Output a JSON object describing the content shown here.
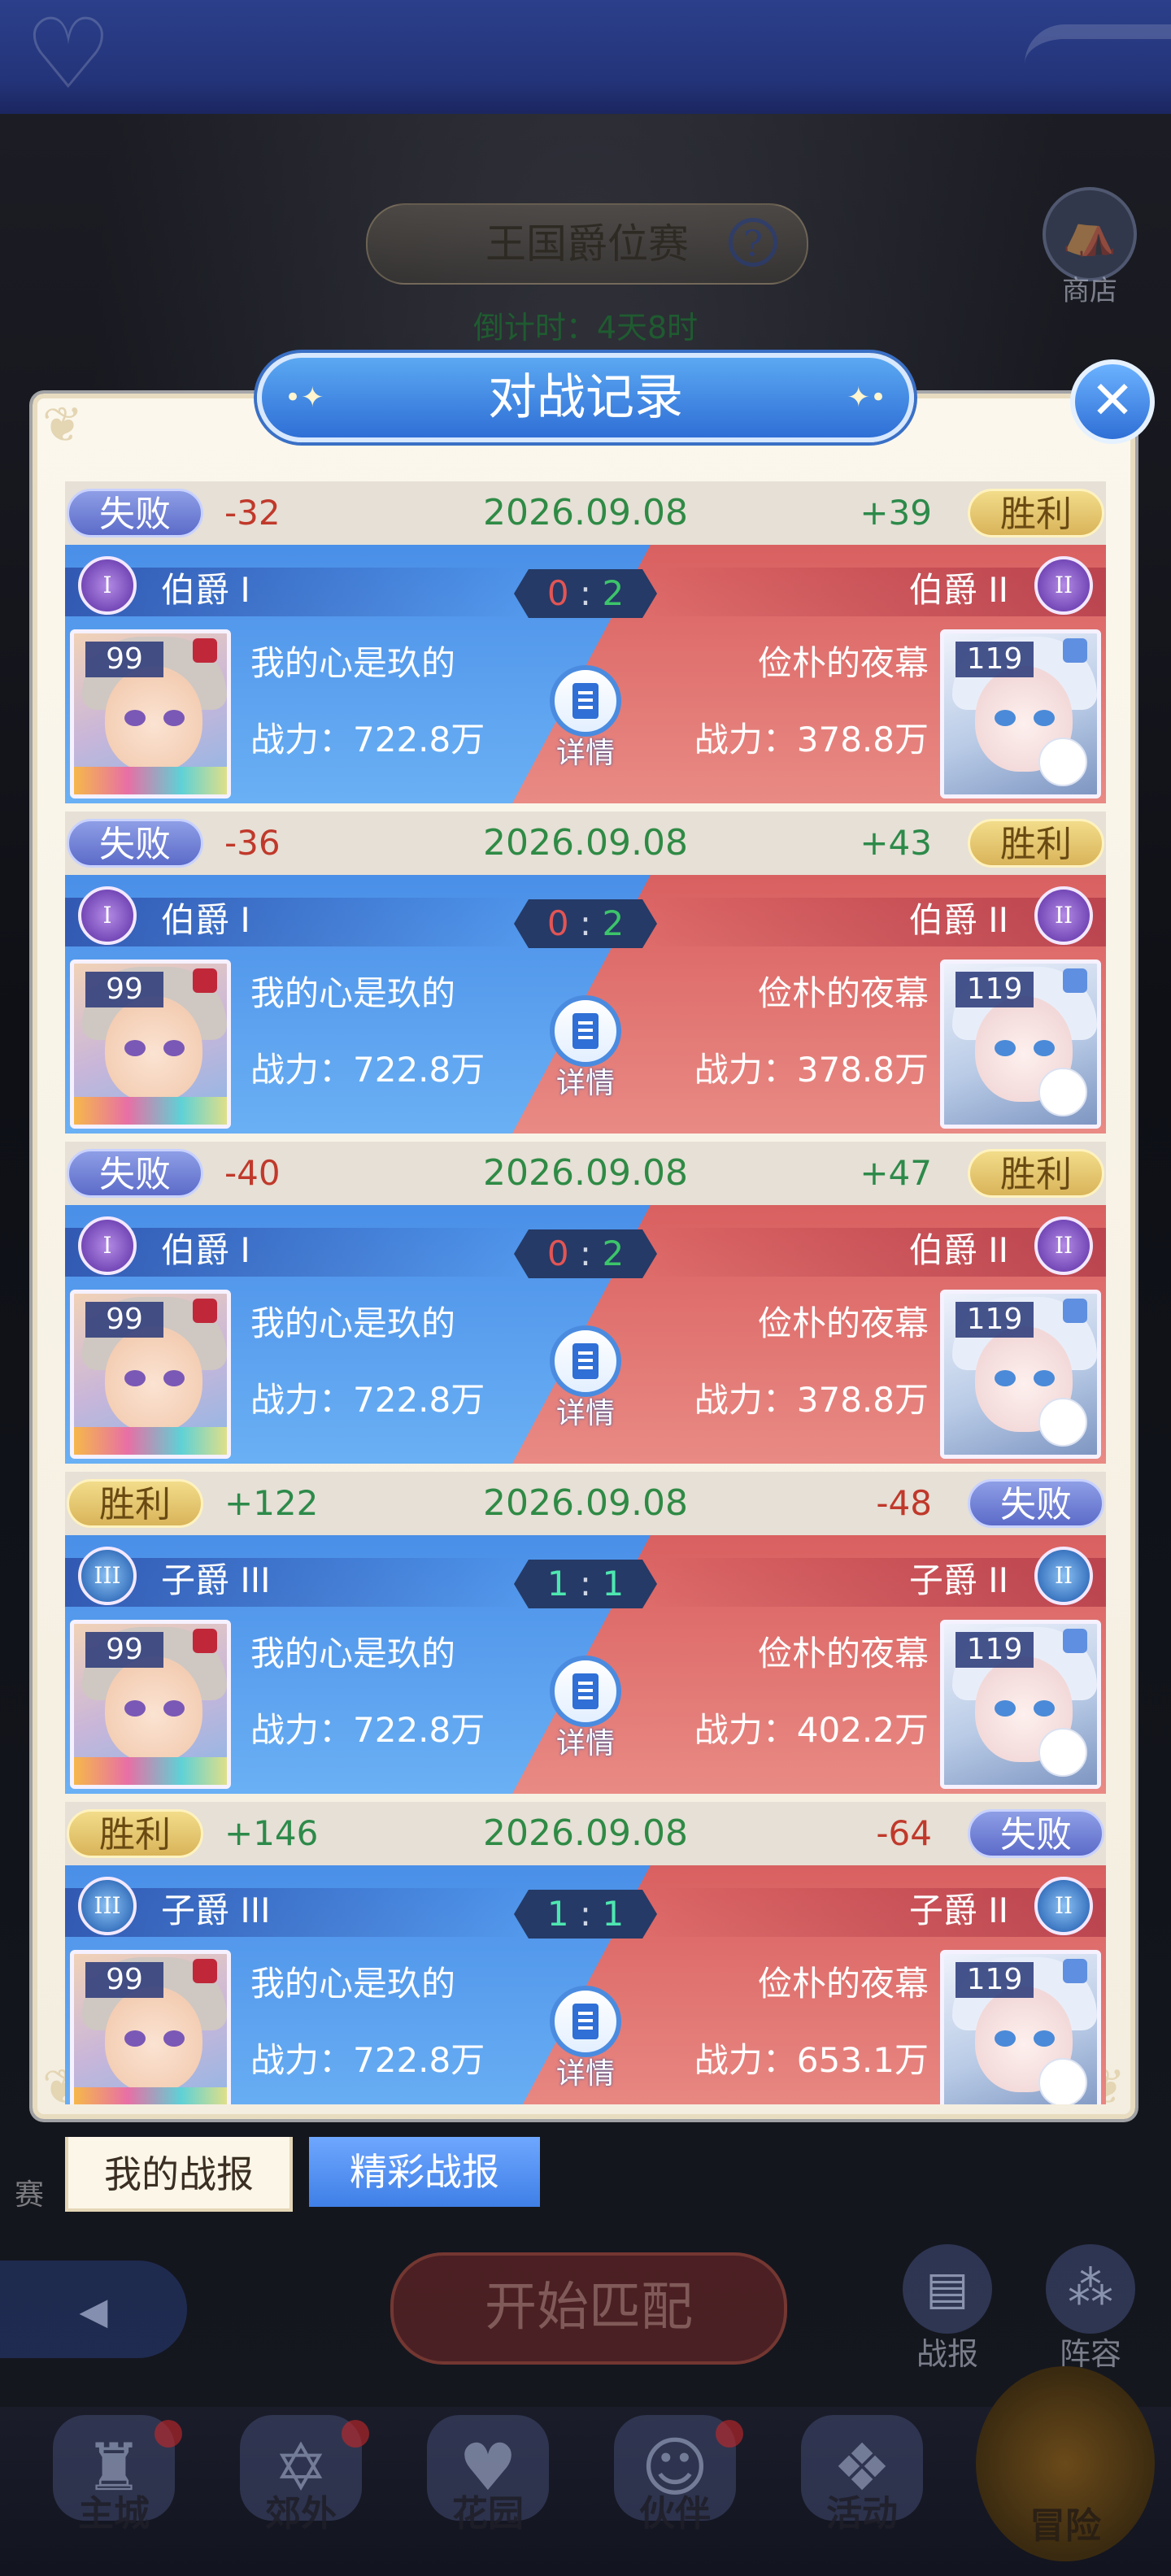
{
  "background": {
    "event_title": "王国爵位赛",
    "countdown": "倒计时：4天8时",
    "shop_label": "商店",
    "match_button": "开始匹配",
    "left_text": "赛",
    "battle_report_label": "战报",
    "lineup_label": "阵容"
  },
  "bottom_nav": {
    "items": [
      {
        "label": "主城"
      },
      {
        "label": "郊外"
      },
      {
        "label": "花园"
      },
      {
        "label": "伙伴"
      },
      {
        "label": "活动"
      },
      {
        "label": "冒险"
      }
    ]
  },
  "modal": {
    "title": "对战记录",
    "close_label": "✕",
    "detail_label": "详情",
    "records": [
      {
        "left_result": "失败",
        "left_delta": "-32",
        "date": "2026.09.08",
        "right_delta": "+39",
        "right_result": "胜利",
        "left_rank": "伯爵 I",
        "left_badge": "I",
        "score_left": "0",
        "score_sep": ":",
        "score_right": "2",
        "right_rank": "伯爵 II",
        "right_badge": "II",
        "left_level": "99",
        "left_name": "我的心是玖的",
        "left_power": "战力：722.8万",
        "right_level": "119",
        "right_name": "俭朴的夜幕",
        "right_power": "战力：378.8万"
      },
      {
        "left_result": "失败",
        "left_delta": "-36",
        "date": "2026.09.08",
        "right_delta": "+43",
        "right_result": "胜利",
        "left_rank": "伯爵 I",
        "left_badge": "I",
        "score_left": "0",
        "score_sep": ":",
        "score_right": "2",
        "right_rank": "伯爵 II",
        "right_badge": "II",
        "left_level": "99",
        "left_name": "我的心是玖的",
        "left_power": "战力：722.8万",
        "right_level": "119",
        "right_name": "俭朴的夜幕",
        "right_power": "战力：378.8万"
      },
      {
        "left_result": "失败",
        "left_delta": "-40",
        "date": "2026.09.08",
        "right_delta": "+47",
        "right_result": "胜利",
        "left_rank": "伯爵 I",
        "left_badge": "I",
        "score_left": "0",
        "score_sep": ":",
        "score_right": "2",
        "right_rank": "伯爵 II",
        "right_badge": "II",
        "left_level": "99",
        "left_name": "我的心是玖的",
        "left_power": "战力：722.8万",
        "right_level": "119",
        "right_name": "俭朴的夜幕",
        "right_power": "战力：378.8万"
      },
      {
        "left_result": "胜利",
        "left_delta": "+122",
        "date": "2026.09.08",
        "right_delta": "-48",
        "right_result": "失败",
        "left_rank": "子爵 III",
        "left_badge": "III",
        "score_left": "1",
        "score_sep": ":",
        "score_right": "1",
        "right_rank": "子爵 II",
        "right_badge": "II",
        "left_level": "99",
        "left_name": "我的心是玖的",
        "left_power": "战力：722.8万",
        "right_level": "119",
        "right_name": "俭朴的夜幕",
        "right_power": "战力：402.2万"
      },
      {
        "left_result": "胜利",
        "left_delta": "+146",
        "date": "2026.09.08",
        "right_delta": "-64",
        "right_result": "失败",
        "left_rank": "子爵 III",
        "left_badge": "III",
        "score_left": "1",
        "score_sep": ":",
        "score_right": "1",
        "right_rank": "子爵 II",
        "right_badge": "II",
        "left_level": "99",
        "left_name": "我的心是玖的",
        "left_power": "战力：722.8万",
        "right_level": "119",
        "right_name": "俭朴的夜幕",
        "right_power": "战力：653.1万"
      }
    ]
  },
  "tabs": {
    "my_reports": "我的战报",
    "highlight_reports": "精彩战报"
  }
}
